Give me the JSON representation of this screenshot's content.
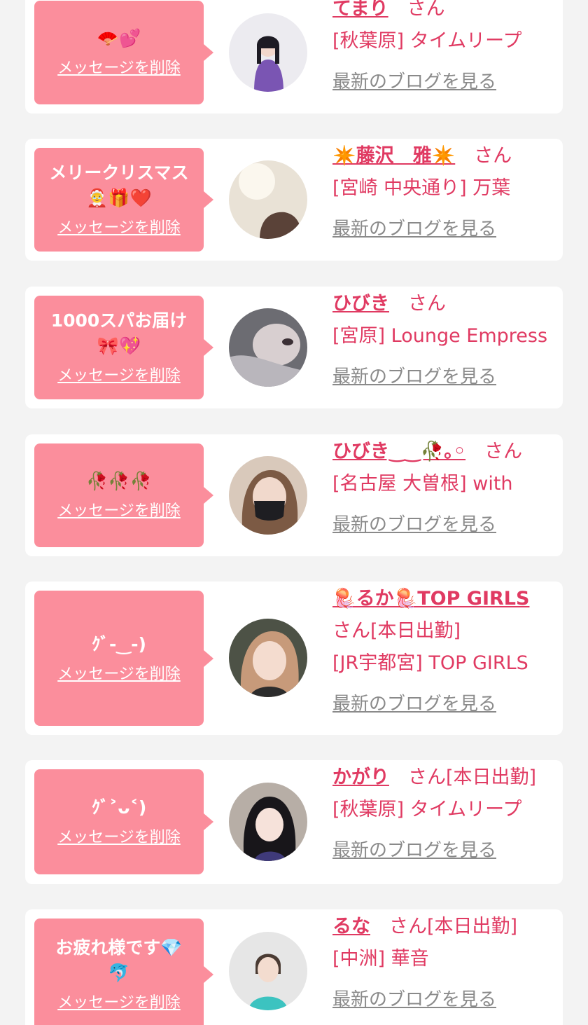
{
  "delete_label": "メッセージを削除",
  "san_label": "さん",
  "blog_label": "最新のブログを見る",
  "colors": {
    "page_bg": "#f3f3f3",
    "card_bg": "#ffffff",
    "bubble_bg": "#fb8e9c",
    "accent_text": "#e03a62",
    "link_gray": "#8a8a8a"
  },
  "cards": [
    {
      "message": "🪭💕",
      "name": "てまり",
      "suffix": "",
      "shop": "[秋葉原] タイムリープ",
      "avatar_icon": "avatar-photo"
    },
    {
      "message": "メリークリスマス\n🤶🎁❤️",
      "name": "✴️藤沢　雅✴️",
      "suffix": "",
      "shop": "[宮崎 中央通り] 万葉",
      "avatar_icon": "avatar-photo"
    },
    {
      "message": "1000スパお届け\n🎀💖",
      "name": "ひびき",
      "suffix": "",
      "shop": "[宮原] Lounge Empress",
      "avatar_icon": "avatar-photo"
    },
    {
      "message": "🥀🥀🥀",
      "name": "ひびき‿‿🥀｡◦",
      "suffix": "",
      "shop": "[名古屋 大曽根] with",
      "avatar_icon": "avatar-photo"
    },
    {
      "message": "ｸﾞ-‿-)",
      "name": "🪼るか🪼TOP GIRLS",
      "suffix": "[本日出勤]",
      "shop": "[JR宇都宮] TOP GIRLS",
      "avatar_icon": "avatar-photo"
    },
    {
      "message": "ｸﾞ˃ᴗ˂)",
      "name": "かがり",
      "suffix": "[本日出勤]",
      "shop": "[秋葉原] タイムリープ",
      "avatar_icon": "avatar-photo"
    },
    {
      "message": "お疲れ様です💎\n🐬",
      "name": "るな",
      "suffix": "[本日出勤]",
      "shop": "[中洲] 華音",
      "avatar_icon": "avatar-photo"
    }
  ]
}
